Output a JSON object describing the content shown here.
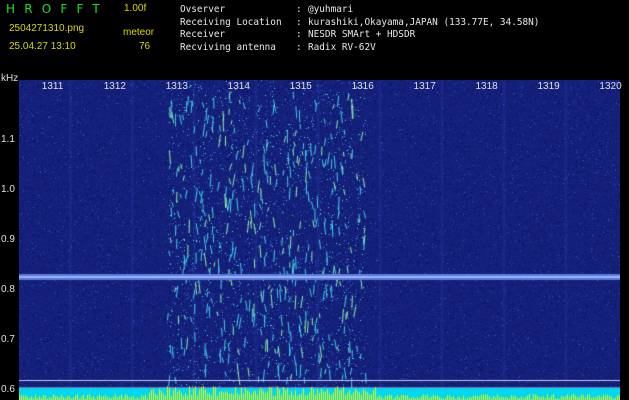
{
  "header": {
    "logo": "HROFFT",
    "version": "1.00f",
    "filename": "2504271310.png",
    "datetime": "25.04.27 13:10",
    "meteor_label": "meteor",
    "meteor_count": "76"
  },
  "station": [
    {
      "label": "Ovserver",
      "value": "@yuhmari"
    },
    {
      "label": "Receiving Location",
      "value": "kurashiki,Okayama,JAPAN (133.77E, 34.58N)"
    },
    {
      "label": "Receiver",
      "value": "NESDR SMArt + HDSDR"
    },
    {
      "label": "Recviving antenna",
      "value": "Radix RV-62V"
    }
  ],
  "separator": ":",
  "y_unit": "kHz",
  "colors": {
    "logo": "#22dd22",
    "yellow_text": "#d8d800",
    "info_text": "#e8e8e8",
    "background": "#000000",
    "spectrogram_base": "#1a2a8a",
    "noise_floor": "#00d8f0",
    "noise_peaks": "#f0f000"
  },
  "chart_data": {
    "type": "heatmap",
    "title": "",
    "xlabel": "",
    "ylabel": "kHz",
    "x_ticks": [
      "1311",
      "1312",
      "1313",
      "1314",
      "1315",
      "1316",
      "1317",
      "1318",
      "1319",
      "1320"
    ],
    "y_ticks": [
      "1.1",
      "1.0",
      "0.9",
      "0.8",
      "0.7",
      "0.6"
    ],
    "ylim": [
      0.58,
      1.22
    ],
    "x_range": [
      1310.6,
      1320.3
    ],
    "carrier_khz": 0.826,
    "meteor_activity_x_range": [
      1313.0,
      1316.2
    ],
    "meteor_count": 76
  }
}
